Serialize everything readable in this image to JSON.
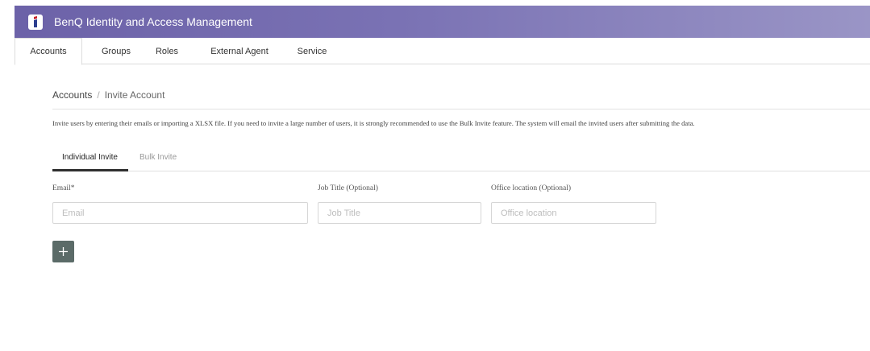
{
  "app": {
    "title": "BenQ Identity and Access Management",
    "header_colors": [
      "#6c62a8",
      "#9a95c6"
    ],
    "logo_icon": "benq-logo-icon"
  },
  "nav": {
    "tabs": [
      {
        "label": "Accounts",
        "active": true
      },
      {
        "label": "Groups",
        "active": false
      },
      {
        "label": "Roles",
        "active": false
      },
      {
        "label": "External Agent",
        "active": false
      },
      {
        "label": "Service",
        "active": false
      }
    ]
  },
  "breadcrumb": {
    "root": "Accounts",
    "separator": "/",
    "current": "Invite Account"
  },
  "description": "Invite users by entering their emails or importing a XLSX file. If you need to invite a large number of users, it is strongly recommended to use the Bulk Invite feature. The system will email the invited users after submitting the data.",
  "invite_tabs": [
    {
      "label": "Individual Invite",
      "active": true
    },
    {
      "label": "Bulk Invite",
      "active": false
    }
  ],
  "form": {
    "email": {
      "label": "Email*",
      "placeholder": "Email",
      "value": ""
    },
    "job_title": {
      "label": "Job Title (Optional)",
      "placeholder": "Job Title",
      "value": ""
    },
    "office_location": {
      "label": "Office location (Optional)",
      "placeholder": "Office location",
      "value": ""
    }
  },
  "add_button": {
    "icon": "plus-icon",
    "color": "#5b6b68"
  }
}
